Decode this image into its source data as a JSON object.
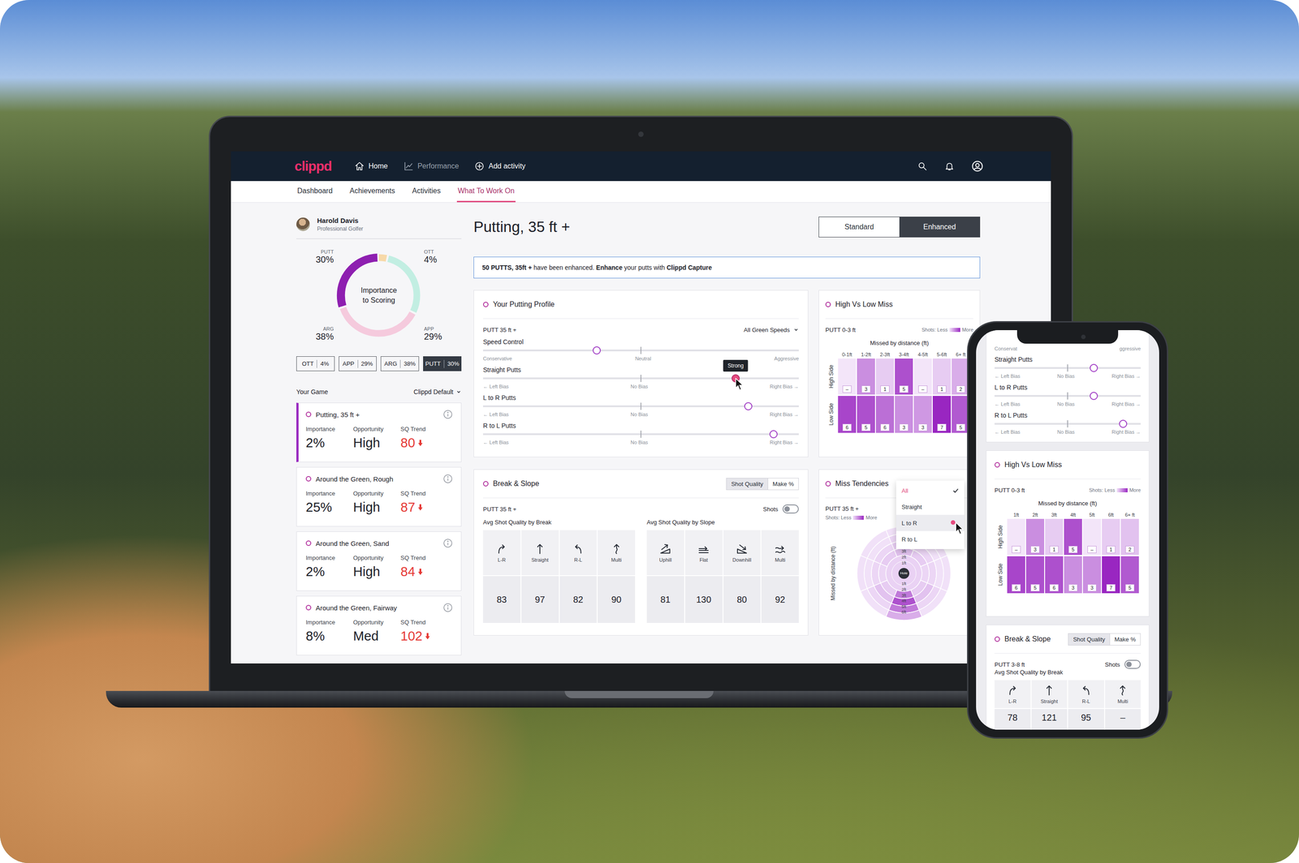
{
  "laptop": {
    "topbar": {
      "logo": "clippd",
      "nav": [
        {
          "label": "Home",
          "dimmed": false
        },
        {
          "label": "Performance",
          "dimmed": true
        },
        {
          "label": "Add activity",
          "dimmed": false
        }
      ]
    },
    "tabs": [
      {
        "label": "Dashboard",
        "selected": false
      },
      {
        "label": "Achievements",
        "selected": false
      },
      {
        "label": "Activities",
        "selected": false
      },
      {
        "label": "What To Work On",
        "selected": true
      }
    ],
    "player": {
      "name": "Harold Davis",
      "role": "Professional Golfer"
    },
    "importance": {
      "center": [
        "Importance",
        "to Scoring"
      ],
      "categories": [
        {
          "label": "OTT",
          "value": "4%",
          "share": 4,
          "color": "#f7d9a8",
          "selected": false
        },
        {
          "label": "APP",
          "value": "29%",
          "share": 29,
          "color": "#c2eee2",
          "selected": false
        },
        {
          "label": "ARG",
          "value": "38%",
          "share": 38,
          "color": "#f5cadd",
          "selected": false
        },
        {
          "label": "PUTT",
          "value": "30%",
          "share": 30,
          "color": "#8e1fb0",
          "selected": true
        }
      ]
    },
    "game": {
      "label": "Your Game",
      "filter": "Clippd Default"
    },
    "focus_labels": {
      "importance": "Importance",
      "opportunity": "Opportunity",
      "trend": "SQ Trend"
    },
    "focus_cards": [
      {
        "title": "Putting, 35 ft +",
        "importance": "2%",
        "opportunity": "High",
        "trend": "80",
        "selected": true
      },
      {
        "title": "Around the Green, Rough",
        "importance": "25%",
        "opportunity": "High",
        "trend": "87",
        "selected": false
      },
      {
        "title": "Around the Green, Sand",
        "importance": "2%",
        "opportunity": "High",
        "trend": "84",
        "selected": false
      },
      {
        "title": "Around the Green, Fairway",
        "importance": "8%",
        "opportunity": "Med",
        "trend": "102",
        "selected": false
      }
    ],
    "title": "Putting, 35 ft +",
    "modes": [
      {
        "label": "Standard",
        "selected": false
      },
      {
        "label": "Enhanced",
        "selected": true
      }
    ],
    "banner": [
      {
        "text": "50 PUTTS, 35ft +",
        "bold": true
      },
      {
        "text": " have been enhanced. ",
        "bold": false
      },
      {
        "text": "Enhance",
        "bold": true
      },
      {
        "text": " your putts with ",
        "bold": false
      },
      {
        "text": "Clippd Capture",
        "bold": true
      }
    ],
    "profile_card": {
      "title": "Your Putting Profile",
      "subtitle": "PUTT 35 ft +",
      "filter": "All Green Speeds",
      "sliders": [
        {
          "label": "Speed Control",
          "scale": [
            "Conservative",
            "Neutral",
            "Aggressive"
          ],
          "level": 0.36,
          "hovered": false
        },
        {
          "label": "Straight Putts",
          "scale": [
            "← Left Bias",
            "No Bias",
            "Right Bias →"
          ],
          "level": 0.8,
          "hovered": true,
          "tooltip": "Strong"
        },
        {
          "label": "L to R Putts",
          "scale": [
            "← Left Bias",
            "No Bias",
            "Right Bias →"
          ],
          "level": 0.84,
          "hovered": false
        },
        {
          "label": "R to L Putts",
          "scale": [
            "← Left Bias",
            "No Bias",
            "Right Bias →"
          ],
          "level": 0.92,
          "hovered": false
        }
      ]
    },
    "miss_card": {
      "title": "High Vs Low Miss",
      "subtitle": "PUTT 0-3 ft",
      "legend": [
        "Shots: Less",
        "More"
      ],
      "axis": "Missed by distance (ft)",
      "columns": [
        "0-1ft",
        "1-2ft",
        "2-3ft",
        "3-4ft",
        "4-5ft",
        "5-6ft",
        "6+ ft"
      ],
      "rows": [
        {
          "label": "High Side",
          "cells": [
            {
              "text": "–",
              "level": 0.03
            },
            {
              "text": "3",
              "level": 0.45
            },
            {
              "text": "1",
              "level": 0.15
            },
            {
              "text": "5",
              "level": 0.75
            },
            {
              "text": "–",
              "level": 0.03
            },
            {
              "text": "1",
              "level": 0.15
            },
            {
              "text": "2",
              "level": 0.3
            }
          ]
        },
        {
          "label": "Low Side",
          "cells": [
            {
              "text": "6",
              "level": 0.8
            },
            {
              "text": "5",
              "level": 0.75
            },
            {
              "text": "6",
              "level": 0.6
            },
            {
              "text": "3",
              "level": 0.45
            },
            {
              "text": "3",
              "level": 0.4
            },
            {
              "text": "7",
              "level": 0.95
            },
            {
              "text": "5",
              "level": 0.7
            }
          ]
        }
      ]
    },
    "break_card": {
      "title": "Break & Slope",
      "modes": [
        {
          "label": "Shot Quality",
          "selected": true
        },
        {
          "label": "Make %",
          "selected": false
        }
      ],
      "subtitle": "PUTT 35 ft +",
      "shots": {
        "label": "Shots",
        "on": false
      },
      "groups": [
        {
          "title": "Avg Shot Quality by Break",
          "items": [
            {
              "label": "L-R",
              "value": "83"
            },
            {
              "label": "Straight",
              "value": "97"
            },
            {
              "label": "R-L",
              "value": "82"
            },
            {
              "label": "Multi",
              "value": "90"
            }
          ]
        },
        {
          "title": "Avg Shot Quality by Slope",
          "items": [
            {
              "label": "Uphill",
              "value": "81"
            },
            {
              "label": "Flat",
              "value": "130"
            },
            {
              "label": "Downhill",
              "value": "80"
            },
            {
              "label": "Multi",
              "value": "92"
            }
          ]
        }
      ]
    },
    "tendencies_card": {
      "title": "Miss Tendencies",
      "subtitle": "PUTT 35 ft +",
      "legend": [
        "Shots: Less",
        "More"
      ],
      "axis": "Missed by distance (ft)",
      "hole": "Hole",
      "ticks_above": [
        "3ft",
        "2ft",
        "1ft"
      ],
      "ticks_below": [
        "1ft",
        "2ft",
        "3ft",
        "4ft",
        "5ft",
        "6ft"
      ],
      "inner_level": 0.12,
      "rings": [
        [
          0.2,
          0.15,
          0.1,
          0.15,
          0.55,
          0.15,
          0.1,
          0.15
        ],
        [
          0.15,
          0.1,
          0.1,
          0.2,
          0.75,
          0.2,
          0.1,
          0.1
        ],
        [
          0.1,
          0.05,
          0.05,
          0.1,
          0.55,
          0.1,
          0.05,
          0.05
        ],
        [
          0.05,
          0.05,
          0.05,
          0.05,
          0.3,
          0.05,
          0.05,
          0.05
        ]
      ],
      "menu": [
        {
          "label": "All",
          "selected": true,
          "hovered": false
        },
        {
          "label": "Straight",
          "selected": false,
          "hovered": false
        },
        {
          "label": "L to R",
          "selected": false,
          "hovered": true
        },
        {
          "label": "R to L",
          "selected": false,
          "hovered": false
        }
      ]
    }
  },
  "phone": {
    "top_cut": [
      "Conservat",
      "ggressive"
    ],
    "sliders": [
      {
        "label": "Straight Putts",
        "scale": [
          "← Left Bias",
          "No Bias",
          "Right Bias →"
        ],
        "level": 0.68
      },
      {
        "label": "L to R Putts",
        "scale": [
          "← Left Bias",
          "No Bias",
          "Right Bias →"
        ],
        "level": 0.68
      },
      {
        "label": "R to L Putts",
        "scale": [
          "← Left Bias",
          "No Bias",
          "Right Bias →"
        ],
        "level": 0.88
      }
    ],
    "miss_card": {
      "title": "High Vs Low Miss",
      "subtitle": "PUTT 0-3 ft",
      "legend": [
        "Shots: Less",
        "More"
      ],
      "axis": "Missed by distance (ft)",
      "columns": [
        "1ft",
        "2ft",
        "3ft",
        "4ft",
        "5ft",
        "6ft",
        "6+ ft"
      ],
      "rows": [
        {
          "label": "High Side",
          "cells": [
            {
              "text": "–",
              "level": 0.03
            },
            {
              "text": "3",
              "level": 0.45
            },
            {
              "text": "1",
              "level": 0.15
            },
            {
              "text": "5",
              "level": 0.75
            },
            {
              "text": "–",
              "level": 0.03
            },
            {
              "text": "1",
              "level": 0.15
            },
            {
              "text": "2",
              "level": 0.2
            }
          ]
        },
        {
          "label": "Low Side",
          "cells": [
            {
              "text": "6",
              "level": 0.8
            },
            {
              "text": "5",
              "level": 0.75
            },
            {
              "text": "6",
              "level": 0.75
            },
            {
              "text": "3",
              "level": 0.45
            },
            {
              "text": "3",
              "level": 0.45
            },
            {
              "text": "7",
              "level": 0.95
            },
            {
              "text": "5",
              "level": 0.7
            }
          ]
        }
      ]
    },
    "break_card": {
      "title": "Break & Slope",
      "modes": [
        {
          "label": "Shot Quality",
          "selected": true
        },
        {
          "label": "Make %",
          "selected": false
        }
      ],
      "subtitle": "PUTT 3-8 ft",
      "shots": {
        "label": "Shots",
        "on": false
      },
      "group": {
        "title": "Avg Shot Quality by Break",
        "items": [
          {
            "label": "L-R",
            "value": "78"
          },
          {
            "label": "Straight",
            "value": "121"
          },
          {
            "label": "R-L",
            "value": "95"
          },
          {
            "label": "Multi",
            "value": "–"
          }
        ]
      }
    }
  }
}
